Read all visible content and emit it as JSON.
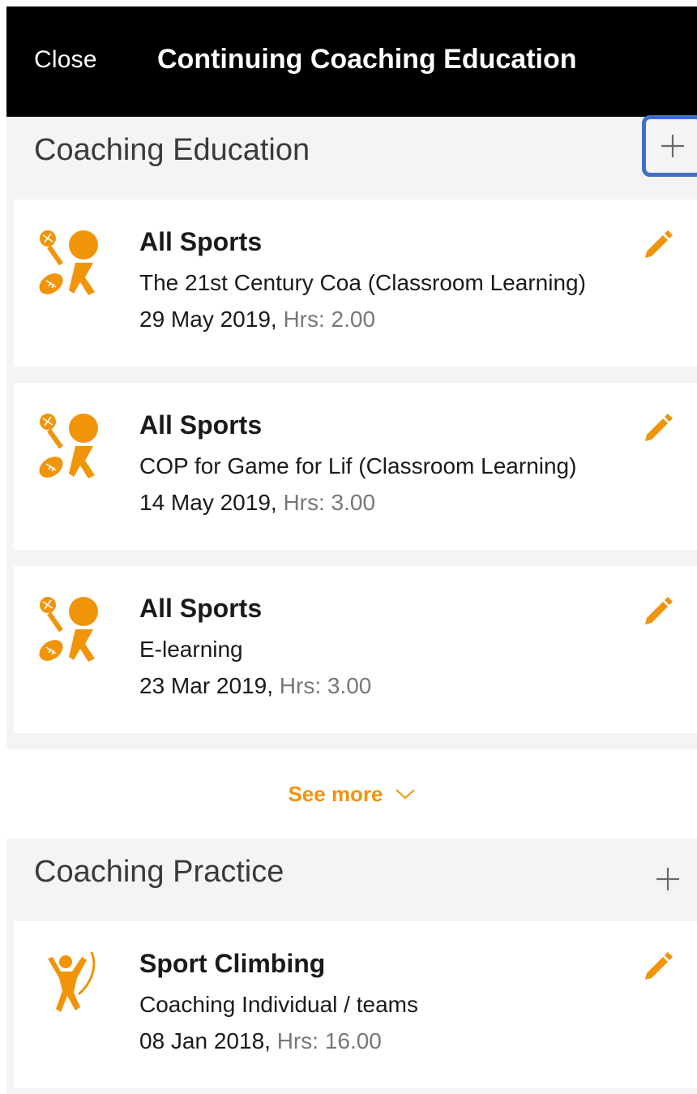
{
  "header": {
    "close_label": "Close",
    "title": "Continuing Coaching Education"
  },
  "colors": {
    "accent": "#f0940a",
    "highlight": "#3f6fc8",
    "header_bg": "#000000"
  },
  "sections": [
    {
      "title": "Coaching Education",
      "add_icon": "plus-icon",
      "items": [
        {
          "icon": "all-sports-icon",
          "title": "All Sports",
          "subtitle": "The 21st Century Coa (Classroom Learning)",
          "date": "29 May 2019,",
          "hrs": "Hrs: 2.00"
        },
        {
          "icon": "all-sports-icon",
          "title": "All Sports",
          "subtitle": "COP for Game for Lif (Classroom Learning)",
          "date": "14 May 2019,",
          "hrs": "Hrs: 3.00"
        },
        {
          "icon": "all-sports-icon",
          "title": "All Sports",
          "subtitle": "E-learning",
          "date": "23 Mar 2019,",
          "hrs": "Hrs: 3.00"
        }
      ],
      "see_more_label": "See more"
    },
    {
      "title": "Coaching Practice",
      "add_icon": "plus-icon",
      "items": [
        {
          "icon": "sport-climbing-icon",
          "title": "Sport Climbing",
          "subtitle": "Coaching Individual / teams",
          "date": "08 Jan 2018,",
          "hrs": "Hrs: 16.00"
        }
      ]
    }
  ]
}
